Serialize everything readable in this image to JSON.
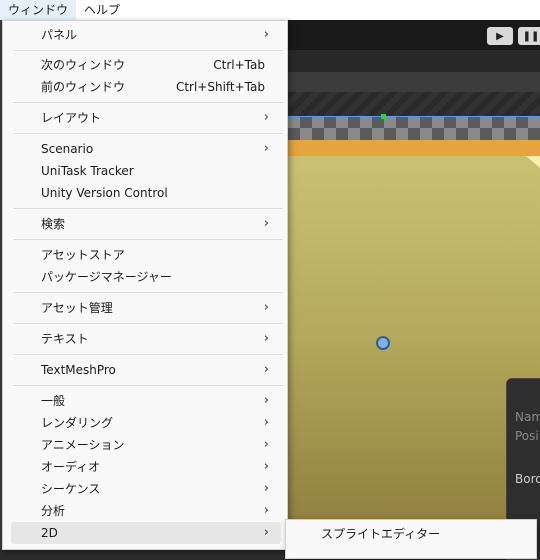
{
  "menubar": {
    "items": [
      "ウィンドウ",
      "ヘルプ"
    ]
  },
  "window_menu": {
    "items": [
      {
        "label": "パネル",
        "arrow": true
      },
      {
        "label": "次のウィンドウ",
        "shortcut": "Ctrl+Tab"
      },
      {
        "label": "前のウィンドウ",
        "shortcut": "Ctrl+Shift+Tab"
      },
      {
        "label": "レイアウト",
        "arrow": true
      },
      {
        "label": "Scenario",
        "arrow": true
      },
      {
        "label": "UniTask Tracker"
      },
      {
        "label": "Unity Version Control"
      },
      {
        "label": "検索",
        "arrow": true
      },
      {
        "label": "アセットストア"
      },
      {
        "label": "パッケージマネージャー"
      },
      {
        "label": "アセット管理",
        "arrow": true
      },
      {
        "label": "テキスト",
        "arrow": true
      },
      {
        "label": "TextMeshPro",
        "arrow": true
      },
      {
        "label": "一般",
        "arrow": true
      },
      {
        "label": "レンダリング",
        "arrow": true
      },
      {
        "label": "アニメーション",
        "arrow": true
      },
      {
        "label": "オーディオ",
        "arrow": true
      },
      {
        "label": "シーケンス",
        "arrow": true
      },
      {
        "label": "分析",
        "arrow": true
      },
      {
        "label": "2D",
        "arrow": true,
        "highlighted": true
      }
    ]
  },
  "submenu_2d": {
    "items": [
      "スプライトエディター"
    ]
  },
  "inspector": {
    "labels": [
      "Nam",
      "Posi",
      "Bord"
    ]
  },
  "icons": {
    "submenu_arrow": "chevron-right-icon",
    "play": "play-icon",
    "pause": "pause-icon"
  },
  "colors": {
    "menu_bg": "#f9f9f9",
    "highlight": "#e7e7e7",
    "scene_yellow": "#c9c173",
    "orange_bar": "#e6a43d"
  }
}
